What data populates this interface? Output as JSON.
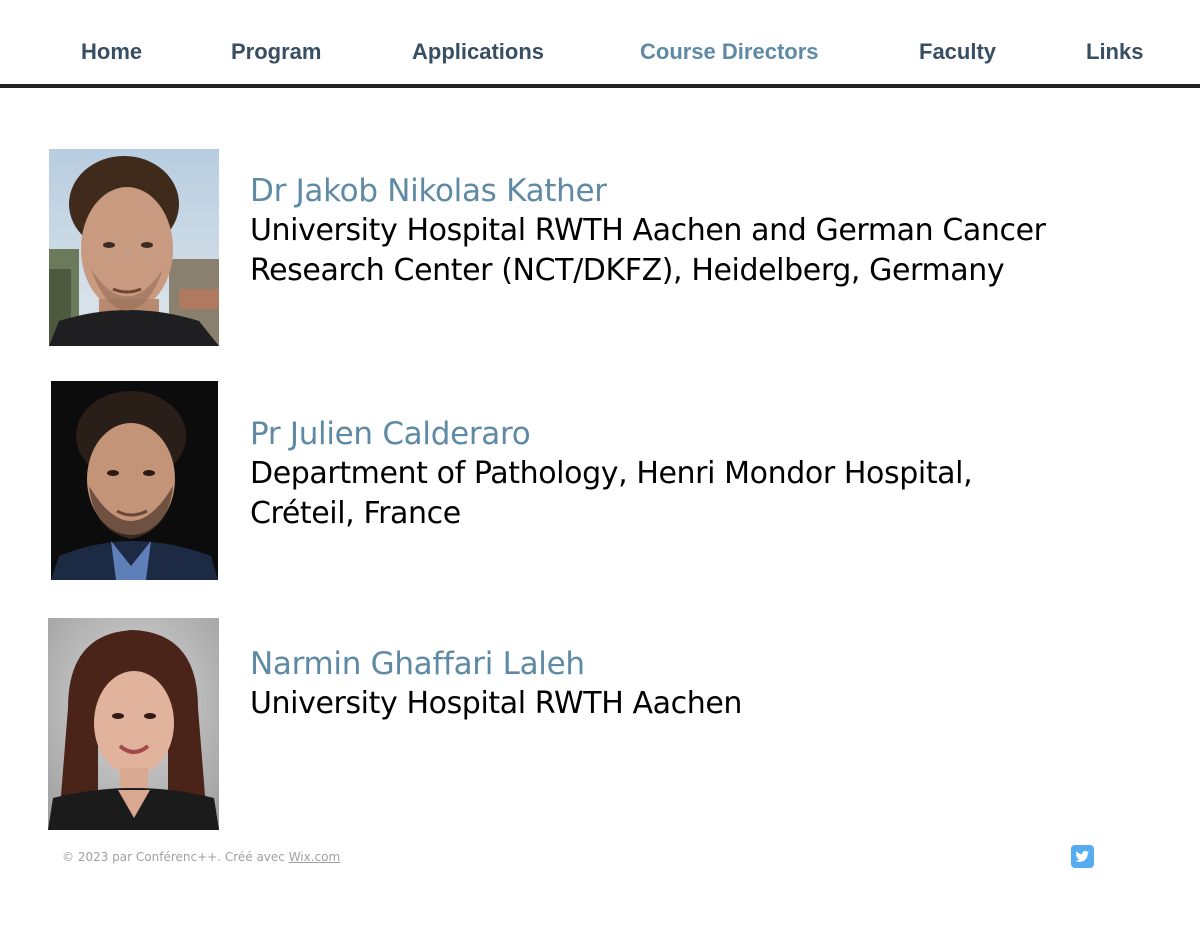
{
  "nav": {
    "items": [
      {
        "label": "Home",
        "active": false
      },
      {
        "label": "Program",
        "active": false
      },
      {
        "label": "Applications",
        "active": false
      },
      {
        "label": "Course Directors",
        "active": true
      },
      {
        "label": "Faculty",
        "active": false
      },
      {
        "label": "Links",
        "active": false
      }
    ],
    "active_color": "#5f8aa5",
    "default_color": "#384e62"
  },
  "directors": [
    {
      "name": "Dr Jakob Nikolas Kather",
      "affiliation_lines": [
        "University Hospital RWTH Aachen and German Cancer",
        "Research Center (NCT/DKFZ), Heidelberg, Germany"
      ]
    },
    {
      "name": "Pr Julien Calderaro",
      "affiliation_lines": [
        "Department of Pathology, Henri Mondor Hospital,",
        "Créteil, France"
      ]
    },
    {
      "name": "Narmin Ghaffari Laleh",
      "affiliation_lines": [
        "University Hospital RWTH Aachen"
      ]
    }
  ],
  "footer": {
    "text": "© 2023 par Conférenc++. Créé avec ",
    "link_label": "Wix.com",
    "social_icon": "twitter-icon"
  },
  "colors": {
    "name": "#5f8aa5",
    "nav_rule": "#222222",
    "twitter": "#55acee"
  }
}
